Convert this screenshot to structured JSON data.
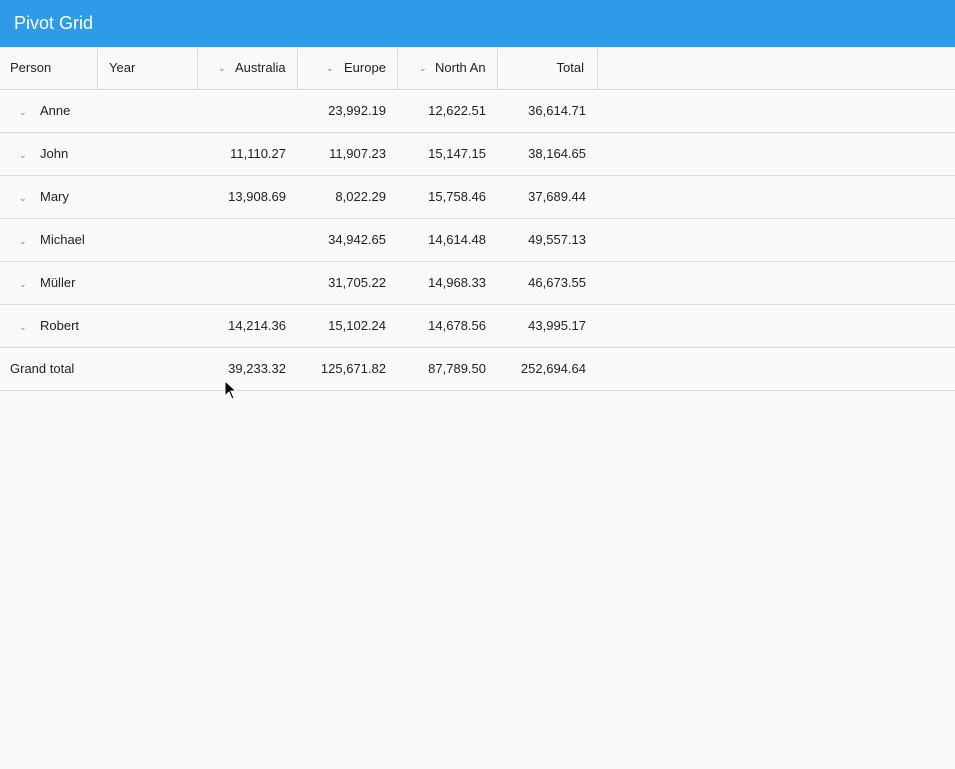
{
  "app": {
    "title": "Pivot Grid"
  },
  "header": {
    "person": "Person",
    "year": "Year",
    "australia": "Australia",
    "europe": "Europe",
    "north_america": "North An",
    "total": "Total",
    "chevron_icon": "chevron-down-icon"
  },
  "rows": [
    {
      "name": "Anne",
      "australia": "",
      "europe": "23,992.19",
      "north_america": "12,622.51",
      "total": "36,614.71"
    },
    {
      "name": "John",
      "australia": "11,110.27",
      "europe": "11,907.23",
      "north_america": "15,147.15",
      "total": "38,164.65"
    },
    {
      "name": "Mary",
      "australia": "13,908.69",
      "europe": "8,022.29",
      "north_america": "15,758.46",
      "total": "37,689.44"
    },
    {
      "name": "Michael",
      "australia": "",
      "europe": "34,942.65",
      "north_america": "14,614.48",
      "total": "49,557.13"
    },
    {
      "name": "Müller",
      "australia": "",
      "europe": "31,705.22",
      "north_america": "14,968.33",
      "total": "46,673.55"
    },
    {
      "name": "Robert",
      "australia": "14,214.36",
      "europe": "15,102.24",
      "north_america": "14,678.56",
      "total": "43,995.17"
    }
  ],
  "grand_total": {
    "label": "Grand total",
    "australia": "39,233.32",
    "europe": "125,671.82",
    "north_america": "87,789.50",
    "total": "252,694.64"
  },
  "colors": {
    "titlebar": "#2e9be9",
    "background": "#f9f9f7",
    "border": "#d8d8d6"
  }
}
